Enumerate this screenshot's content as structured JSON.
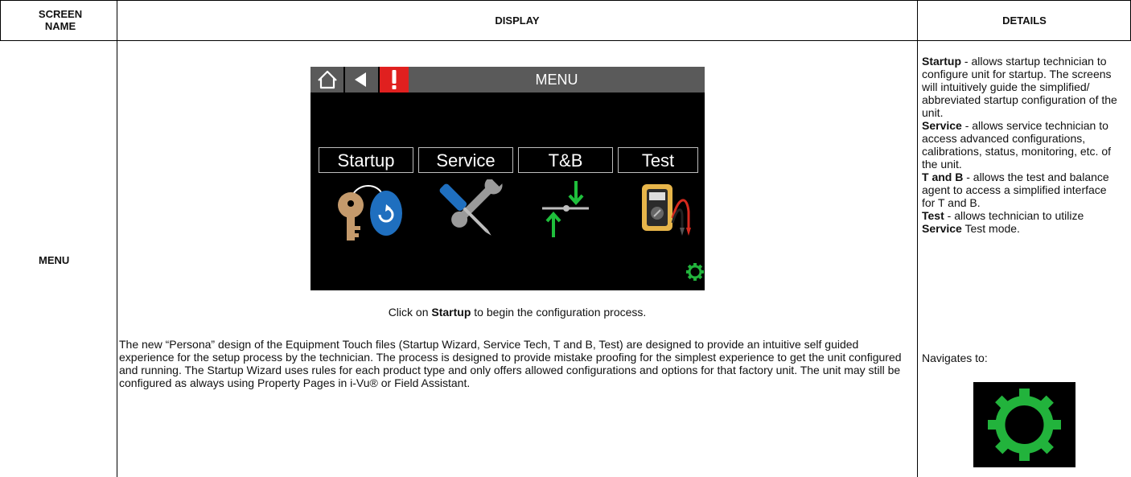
{
  "table": {
    "headers": [
      "SCREEN NAME",
      "DISPLAY",
      "DETAILS"
    ],
    "row": {
      "screen_name": "MENU",
      "display": {
        "device": {
          "title": "MENU",
          "tiles": [
            {
              "label": "Startup",
              "icon": "key-fob-icon"
            },
            {
              "label": "Service",
              "icon": "screwdriver-wrench-icon"
            },
            {
              "label": "T&B",
              "icon": "balance-arrows-icon"
            },
            {
              "label": "Test",
              "icon": "multimeter-icon"
            }
          ],
          "top_icons": [
            "home-icon",
            "back-arrow-icon",
            "alert-icon"
          ],
          "corner_icon": "gear-icon",
          "colors": {
            "bar": "#5a5a5a",
            "alert": "#e0201f",
            "screen": "#000000",
            "gear": "#22b33c"
          }
        },
        "caption": {
          "before": "Click on ",
          "bold": "Startup",
          "after": " to begin the configuration process."
        },
        "paragraph": "The new “Persona” design of the Equipment Touch files (Startup Wizard, Service Tech, T and B, Test) are designed to provide an intuitive self guided experience for the setup process by the technician. The process is designed to provide mistake proofing for the simplest experience to get the unit configured and running.  The Startup Wizard uses rules for each product type and only offers allowed configurations and options for that factory unit.  The unit may still be configured as always using Property Pages in i-Vu® or Field Assistant."
      },
      "details": {
        "items": [
          {
            "term": "Startup",
            "text": " - allows startup technician to configure unit for startup. The screens will intuitively guide the simplified/ abbreviated startup configuration of the unit."
          },
          {
            "term": "Service",
            "text": " - allows service technician to access advanced configurations, calibrations, status, monitoring, etc. of the unit."
          },
          {
            "term": "T and B",
            "text": " - allows the test and balance agent to access a simplified interface for T and B."
          },
          {
            "term_prefix": "Test",
            "middle": " - allows technician to utilize ",
            "term2": "Service",
            "suffix": " Test mode."
          }
        ],
        "navigates_to": "Navigates to:",
        "navigates_icon": "gear-icon"
      }
    }
  }
}
